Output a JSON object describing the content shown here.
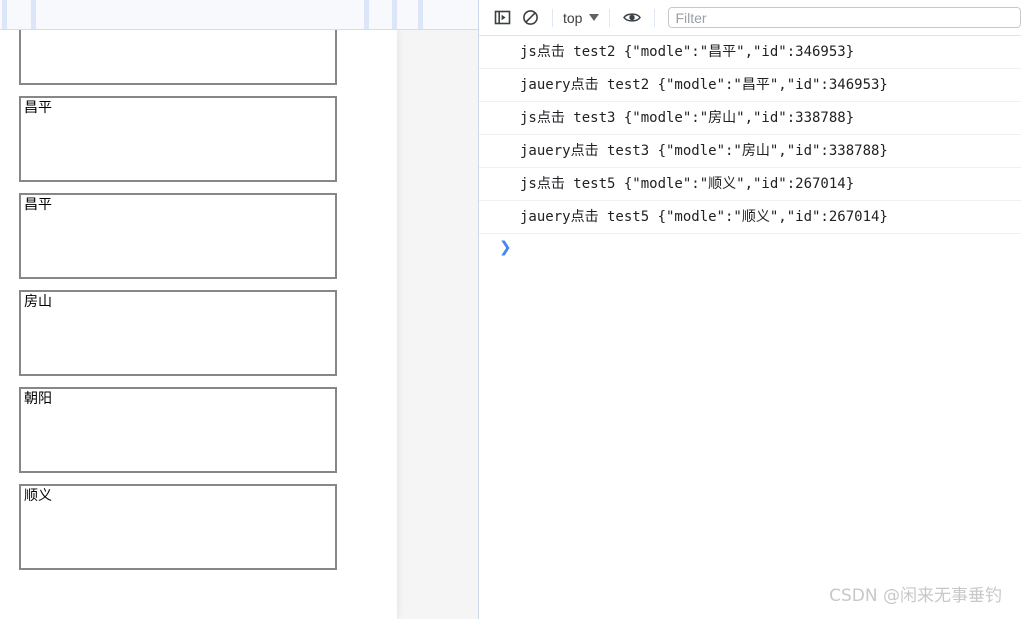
{
  "browser": {
    "chrome_divider_positions": [
      2,
      31,
      364,
      392,
      418
    ]
  },
  "page": {
    "textareas": [
      {
        "value": ""
      },
      {
        "value": "昌平"
      },
      {
        "value": "昌平"
      },
      {
        "value": "房山"
      },
      {
        "value": "朝阳"
      },
      {
        "value": "顺义"
      }
    ]
  },
  "devtools": {
    "toolbar": {
      "sidebar_toggle_icon": "show-console-sidebar-icon",
      "clear_console_icon": "clear-console-icon",
      "context_label": "top",
      "context_caret_icon": "chevron-down-icon",
      "eye_icon": "live-expression-eye-icon",
      "filter_placeholder": "Filter",
      "filter_value": ""
    },
    "console": {
      "messages": [
        "js点击 test2 {\"modle\":\"昌平\",\"id\":346953}",
        "jauery点击 test2 {\"modle\":\"昌平\",\"id\":346953}",
        "js点击 test3 {\"modle\":\"房山\",\"id\":338788}",
        "jauery点击 test3 {\"modle\":\"房山\",\"id\":338788}",
        "js点击 test5 {\"modle\":\"顺义\",\"id\":267014}",
        "jauery点击 test5 {\"modle\":\"顺义\",\"id\":267014}"
      ],
      "prompt_chevron": "❯"
    }
  },
  "watermark": {
    "text": "CSDN @闲来无事垂钓"
  },
  "colors": {
    "prompt_blue": "#4285f4",
    "chrome_bg": "#f7f9fc",
    "chrome_divider": "#dde5f8",
    "textarea_border": "#878787",
    "console_text": "#202124",
    "watermark": "#c8c8c8"
  }
}
